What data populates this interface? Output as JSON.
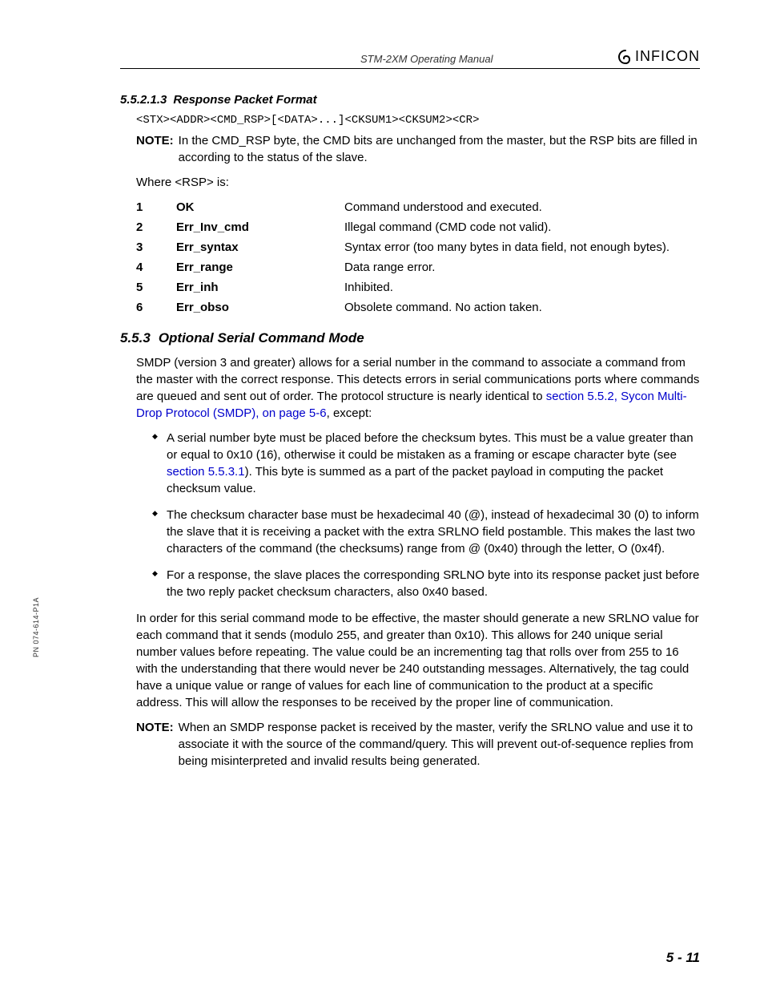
{
  "header": {
    "doc_title": "STM-2XM Operating Manual",
    "brand": "INFICON"
  },
  "side_pn": "PN 074-614-P1A",
  "page_number": "5 - 11",
  "sec1": {
    "num": "5.5.2.1.3",
    "title": "Response Packet Format",
    "packet": "<STX><ADDR><CMD_RSP>[<DATA>...]<CKSUM1><CKSUM2><CR>",
    "note_label": "NOTE:",
    "note_text": "In the CMD_RSP byte, the CMD bits are unchanged from the master, but the RSP bits are filled in according to the status of the slave.",
    "where": "Where <RSP> is:",
    "rows": [
      {
        "n": "1",
        "name": "OK",
        "desc": "Command understood and executed."
      },
      {
        "n": "2",
        "name": "Err_Inv_cmd",
        "desc": "Illegal command (CMD code not valid)."
      },
      {
        "n": "3",
        "name": "Err_syntax",
        "desc": "Syntax error (too many bytes in data field, not enough bytes)."
      },
      {
        "n": "4",
        "name": "Err_range",
        "desc": "Data range error."
      },
      {
        "n": "5",
        "name": "Err_inh",
        "desc": "Inhibited."
      },
      {
        "n": "6",
        "name": "Err_obso",
        "desc": "Obsolete command. No action taken."
      }
    ]
  },
  "sec2": {
    "num": "5.5.3",
    "title": "Optional Serial Command Mode",
    "para1_a": "SMDP (version 3 and greater) allows for a serial number in the command to associate a command from the master with the correct response. This detects errors in serial communications ports where commands are queued and sent out of order. The protocol structure is nearly identical to ",
    "para1_link": "section 5.5.2, Sycon Multi-Drop Protocol (SMDP), on page 5-6",
    "para1_b": ", except:",
    "b1_a": "A serial number byte must be placed before the checksum bytes. This must be a value greater than or equal to 0x10 (16), otherwise it could be mistaken as a framing or escape character byte (see ",
    "b1_link": "section 5.5.3.1",
    "b1_b": "). This byte is summed as a part of the packet payload in computing the packet checksum value.",
    "b2": "The checksum character base must be hexadecimal 40 (@), instead of hexadecimal 30 (0) to inform the slave that it is receiving a packet with the extra SRLNO field postamble. This makes the last two characters of the command (the checksums) range from @ (0x40) through the letter, O (0x4f).",
    "b3": "For a response, the slave places the corresponding SRLNO byte into its response packet just before the two reply packet checksum characters, also 0x40 based.",
    "para2": "In order for this serial command mode to be effective, the master should generate a new SRLNO value for each command that it sends (modulo 255, and greater than 0x10). This allows for 240 unique serial number values before repeating. The value could be an incrementing tag that rolls over from 255 to 16 with the understanding that there would never be 240 outstanding messages. Alternatively, the tag could have a unique value or range of values for each line of communication to the product at a specific address. This will allow the responses to be received by the proper line of communication.",
    "note_label": "NOTE:",
    "note_text": "When an SMDP response packet is received by the master, verify the SRLNO value and use it to associate it with the source of the command/query. This will prevent out-of-sequence replies from being misinterpreted and invalid results being generated."
  }
}
